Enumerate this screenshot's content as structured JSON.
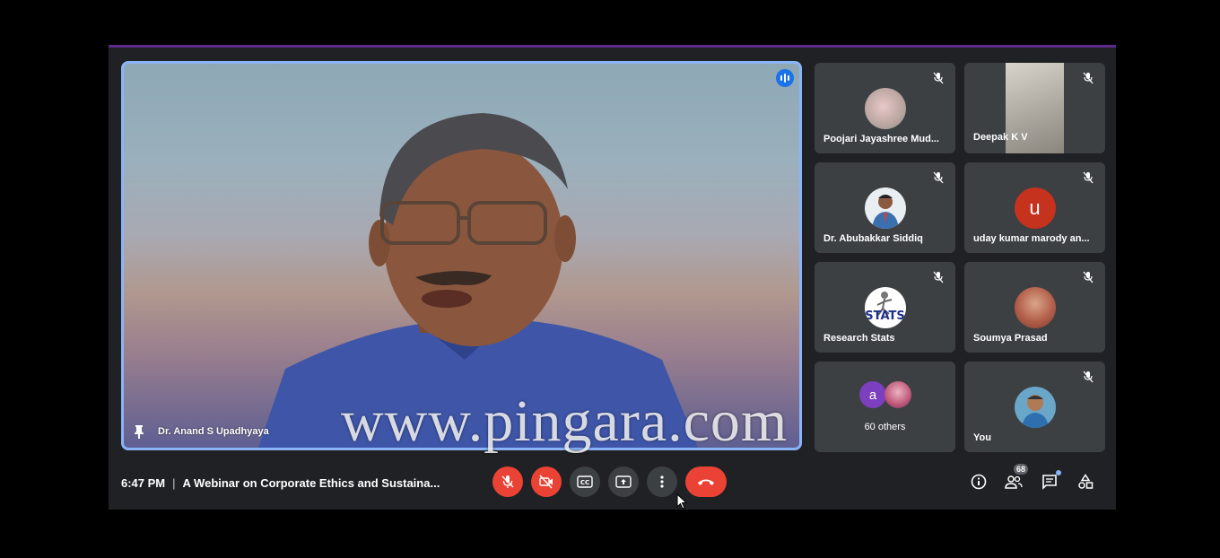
{
  "main_speaker": {
    "name": "Dr. Anand S Upadhyaya"
  },
  "participants": [
    {
      "name": "Poojari Jayashree Mud...",
      "avatar": "photo-flower"
    },
    {
      "name": "Deepak K V",
      "avatar": "video"
    },
    {
      "name": "Dr. Abubakkar Siddiq",
      "avatar": "photo-man"
    },
    {
      "name": "uday kumar marody an...",
      "avatar_letter": "u"
    },
    {
      "name": "Research Stats",
      "avatar_text": "STATS"
    },
    {
      "name": "Soumya Prasad",
      "avatar": "photo-woman"
    },
    {
      "name": "60 others",
      "avatar_letter": "a"
    },
    {
      "name": "You",
      "avatar": "photo-man2"
    }
  ],
  "bottom_bar": {
    "time": "6:47 PM",
    "separator": "|",
    "meeting_title": "A Webinar on Corporate Ethics and Sustaina...",
    "people_count": "68"
  },
  "watermark": "www.pingara.com",
  "colors": {
    "accent": "#8ab4f8",
    "danger": "#ea4335",
    "tile_bg": "#3c4043",
    "window_bg": "#202124"
  },
  "icons": [
    "mic-off-icon",
    "camera-off-icon",
    "captions-icon",
    "present-icon",
    "more-options-icon",
    "end-call-icon",
    "info-icon",
    "people-icon",
    "chat-icon",
    "activities-icon",
    "pin-icon",
    "speaking-icon"
  ]
}
